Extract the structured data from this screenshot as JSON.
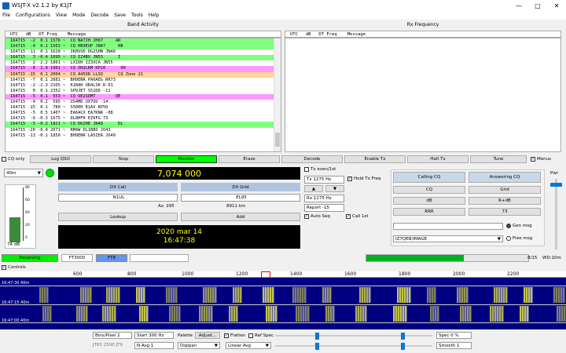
{
  "window": {
    "title": "WSJT-X  v2.1.2  by K1JT"
  },
  "menu": [
    "File",
    "Configurations",
    "View",
    "Mode",
    "Decode",
    "Save",
    "Tools",
    "Help"
  ],
  "band_activity": {
    "title": "Band Activity",
    "header": "UTC   dB   DT Freq    Message",
    "rows": [
      {
        "text": "164715  -2  0.1 1576 ~  CQ NA7JH JH67     AR",
        "color": "#80ff80"
      },
      {
        "text": "164715  -4  0.1 1563 ~  CQ HB9EUP JN47     HB",
        "color": "#80ff80"
      },
      {
        "text": "164715 -11  0.1 1628 ~  IK0USD DG2SHN JN48",
        "color": ""
      },
      {
        "text": "164715   3 -0.4 1695 ~  CQ IZ4BV JN53      I",
        "color": "#80ff80"
      },
      {
        "text": "164715   2  2.2 1801 ~  LX1DH IZ3XCA JN55",
        "color": ""
      },
      {
        "text": "164715  -8  1.9 1901 ~  CQ OH2LKM KP20      OH",
        "color": "#ff99ff"
      },
      {
        "text": "164715 -15  0.1 2004 ~  CQ A45XR LL93      CQ Zone 21",
        "color": "#ffd699"
      },
      {
        "text": "164715  -7  0.1 2081 ~  BH9ENR PA0AEG RR73",
        "color": ""
      },
      {
        "text": "164715  -2 -2.3 2165 ~  R1BAH UR4LSK R-01",
        "color": ""
      },
      {
        "text": "164715   0  0.1 2352 ~  SP9JET S51DD -11",
        "color": ""
      },
      {
        "text": "164715  -5  0.1  553 ~  CQ OE2SDMT        OE",
        "color": "#ff99ff"
      },
      {
        "text": "164715  -4  0.2  595 ~  US4MD UX7UU -14",
        "color": ""
      },
      {
        "text": "164715 -15  0.1  780 ~  S50EH R1AV KP50",
        "color": ""
      },
      {
        "text": "164715  -5  0.5 1407 ~  EA6ACX EA7KNA -08",
        "color": ""
      },
      {
        "text": "164715  -6 -0.3 1675 ~  DL8HFR EZ6FG 73",
        "color": ""
      },
      {
        "text": "164715  -5 -0.2 1821 ~  CQ DK2HE JN48      DL",
        "color": "#80ff80"
      },
      {
        "text": "164715 -20 -0.0 2071 ~  RM4W DL1BBO JO43",
        "color": ""
      },
      {
        "text": "164715 -13 -0.1 1850 ~  BH9ENR LA5IEA JO49",
        "color": ""
      }
    ]
  },
  "rx_frequency": {
    "title": "Rx Frequency",
    "header": "UTC   dB   DT Freq    Message"
  },
  "controls_row": {
    "cq_only": "CQ only",
    "log_qso": "Log QSO",
    "stop": "Stop",
    "monitor": "Monitor",
    "erase": "Erase",
    "decode": "Decode",
    "enable_tx": "Enable Tx",
    "halt_tx": "Halt Tx",
    "tune": "Tune",
    "menus": "Menus"
  },
  "band": {
    "value": "40m"
  },
  "frequency": "7,074 000",
  "level_db": "74 dB",
  "meter_ticks": [
    "80",
    "60",
    "40",
    "20",
    "0"
  ],
  "meter_level": 0.47,
  "dx": {
    "call_label": "DX Call",
    "grid_label": "DX Grid",
    "call_value": "N1UL",
    "grid_value": "EL95",
    "az": "Az: 295",
    "dist": "8911 km",
    "lookup": "Lookup",
    "add": "Add"
  },
  "clock": {
    "date": "2020 mar 14",
    "time": "16:47:38"
  },
  "tx_settings": {
    "tx_even": "Tx even/1st",
    "tx_freq": "Tx  1275  Hz",
    "hold_tx_freq": "Hold Tx Freq",
    "rx_freq": "Rx  1275  Hz",
    "report": "Report  -15",
    "auto_seq": "Auto Seq",
    "call_1st": "Call 1st",
    "up_arrow": "▲",
    "down_arrow": "▼"
  },
  "macros": {
    "calling_cq": "Calling CQ",
    "answering_cq": "Answering CQ",
    "cq": "CQ",
    "grid": "Grid",
    "db": "dB",
    "r_db": "R+dB",
    "rrr": "RRR",
    "seventy_three": "73",
    "free_text": "IZ7QEB/IMAGE",
    "gen_msg": "Gen msg",
    "free_msg": "Free msg"
  },
  "pwr": "Pwr",
  "status": {
    "receiving": "Receiving",
    "mode1": "FT3000",
    "mode2": "FT8",
    "count": "8/15",
    "wd": "WD:10m",
    "progress": 0.6
  },
  "waterfall": {
    "controls": "Controls",
    "ticks": [
      "600",
      "800",
      "1000",
      "1200",
      "1400",
      "1600",
      "1800",
      "2000",
      "2200"
    ],
    "labels": [
      "16:47:30  40m",
      "16:47:15  40m",
      "16:47:00  40m"
    ]
  },
  "wf_controls": {
    "bins": "Bins/Pixel  2",
    "start": "Start  300 Hz",
    "jt65": "JT65  2500  JT9",
    "navg": "N Avg  1",
    "palette": "Palette",
    "adjust": "Adjust...",
    "palette_value": "Digipan",
    "flatten": "Flatten",
    "ref_spec": "Ref Spec",
    "avg": "Linear Avg",
    "spec": "Spec  0 %",
    "smooth": "Smooth  1"
  }
}
